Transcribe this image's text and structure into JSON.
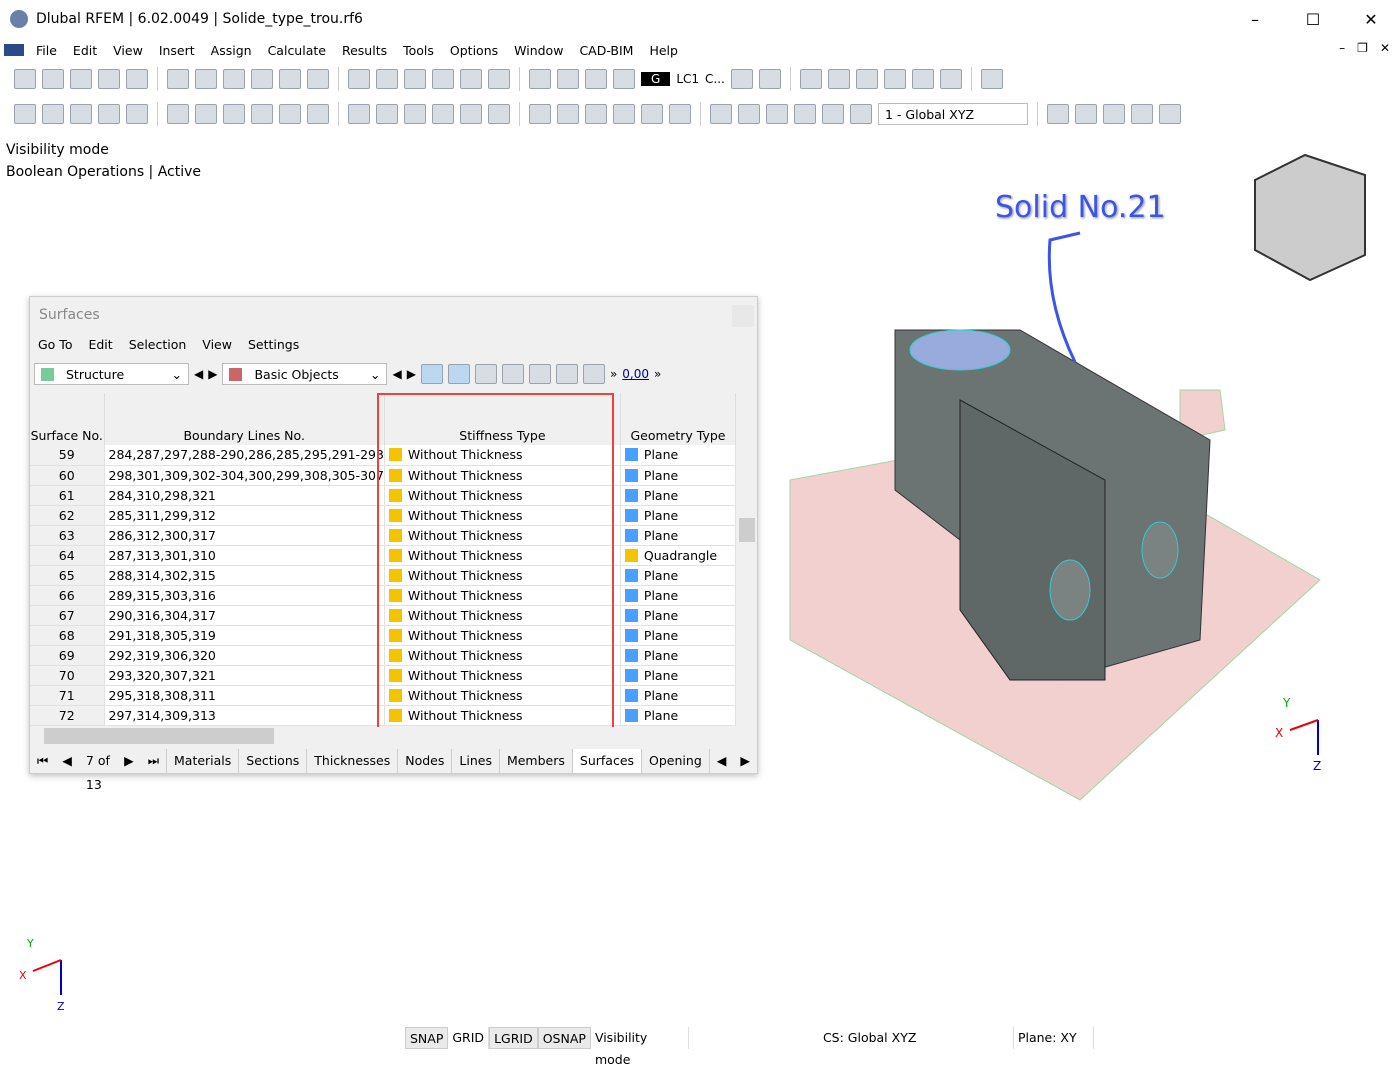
{
  "window": {
    "title": "Dlubal RFEM | 6.02.0049 | Solide_type_trou.rf6"
  },
  "menu": [
    "File",
    "Edit",
    "View",
    "Insert",
    "Assign",
    "Calculate",
    "Results",
    "Tools",
    "Options",
    "Window",
    "CAD-BIM",
    "Help"
  ],
  "toolbar": {
    "load_case": "G",
    "lc": "LC1",
    "lc_combo": "C...",
    "coord_system": "1 - Global XYZ"
  },
  "viewport": {
    "mode_line1": "Visibility mode",
    "mode_line2": "Boolean Operations | Active",
    "solid_label": "Solid No.21",
    "axes": {
      "x": "X",
      "y": "Y",
      "z": "Z"
    }
  },
  "panel": {
    "title": "Surfaces",
    "menu": [
      "Go To",
      "Edit",
      "Selection",
      "View",
      "Settings"
    ],
    "structure_combo": "Structure",
    "objects_combo": "Basic Objects",
    "decimal_icon": "0,00",
    "columns": [
      "Surface No.",
      "Boundary Lines No.",
      "Stiffness Type",
      "Geometry Type"
    ],
    "colors": {
      "without_thickness": "#f5c400",
      "plane": "#4aa0ff",
      "quadrangle": "#f5c400"
    },
    "rows": [
      [
        "59",
        "284,287,297,288-290,286,285,295,291-293",
        "Without Thickness",
        "Plane"
      ],
      [
        "60",
        "298,301,309,302-304,300,299,308,305-307",
        "Without Thickness",
        "Plane"
      ],
      [
        "61",
        "284,310,298,321",
        "Without Thickness",
        "Plane"
      ],
      [
        "62",
        "285,311,299,312",
        "Without Thickness",
        "Plane"
      ],
      [
        "63",
        "286,312,300,317",
        "Without Thickness",
        "Plane"
      ],
      [
        "64",
        "287,313,301,310",
        "Without Thickness",
        "Quadrangle"
      ],
      [
        "65",
        "288,314,302,315",
        "Without Thickness",
        "Plane"
      ],
      [
        "66",
        "289,315,303,316",
        "Without Thickness",
        "Plane"
      ],
      [
        "67",
        "290,316,304,317",
        "Without Thickness",
        "Plane"
      ],
      [
        "68",
        "291,318,305,319",
        "Without Thickness",
        "Plane"
      ],
      [
        "69",
        "292,319,306,320",
        "Without Thickness",
        "Plane"
      ],
      [
        "70",
        "293,320,307,321",
        "Without Thickness",
        "Plane"
      ],
      [
        "71",
        "295,318,308,311",
        "Without Thickness",
        "Plane"
      ],
      [
        "72",
        "297,314,309,313",
        "Without Thickness",
        "Plane"
      ]
    ],
    "pager": "7 of 13",
    "tabs": [
      "Materials",
      "Sections",
      "Thicknesses",
      "Nodes",
      "Lines",
      "Members",
      "Surfaces",
      "Opening"
    ],
    "active_tab": "Surfaces"
  },
  "status": {
    "snap": "SNAP",
    "grid": "GRID",
    "lgrid": "LGRID",
    "osnap": "OSNAP",
    "mode": "Visibility mode",
    "cs": "CS: Global XYZ",
    "plane": "Plane: XY"
  }
}
